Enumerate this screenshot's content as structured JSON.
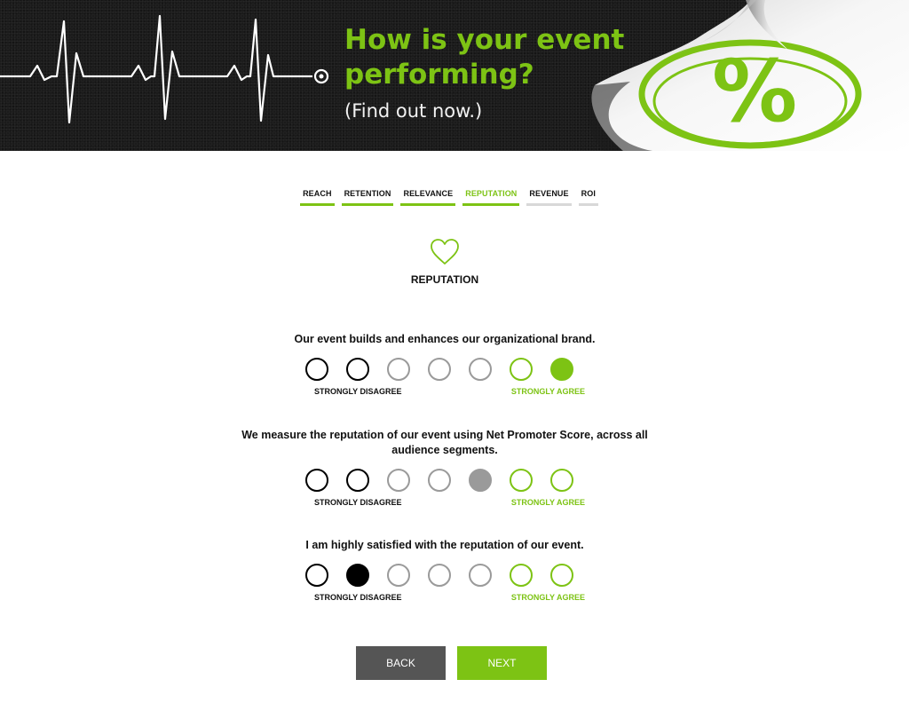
{
  "hero": {
    "title": "How is your event performing?",
    "subtitle": "(Find out now.)",
    "badge_symbol": "%"
  },
  "tabs": [
    {
      "label": "REACH",
      "state": "done"
    },
    {
      "label": "RETENTION",
      "state": "done"
    },
    {
      "label": "RELEVANCE",
      "state": "done"
    },
    {
      "label": "REPUTATION",
      "state": "active"
    },
    {
      "label": "REVENUE",
      "state": "upcoming"
    },
    {
      "label": "ROI",
      "state": "upcoming"
    }
  ],
  "section": {
    "title": "REPUTATION",
    "icon": "heart-icon"
  },
  "scale": {
    "low_label": "STRONGLY DISAGREE",
    "high_label": "STRONGLY AGREE",
    "option_colors": [
      "black",
      "black",
      "gray",
      "gray",
      "gray",
      "green",
      "green"
    ]
  },
  "questions": [
    {
      "text": "Our event builds and enhances our organizational brand.",
      "selected": 7
    },
    {
      "text": "We measure the reputation of our event using Net Promoter Score, across all audience segments.",
      "selected": 5
    },
    {
      "text": "I am highly satisfied with the reputation of our event.",
      "selected": 2
    }
  ],
  "buttons": {
    "back": "BACK",
    "next": "NEXT"
  },
  "colors": {
    "accent": "#7dc314",
    "dark": "#1b1b1b",
    "gray": "#9a9a9a",
    "back_button": "#555555"
  }
}
